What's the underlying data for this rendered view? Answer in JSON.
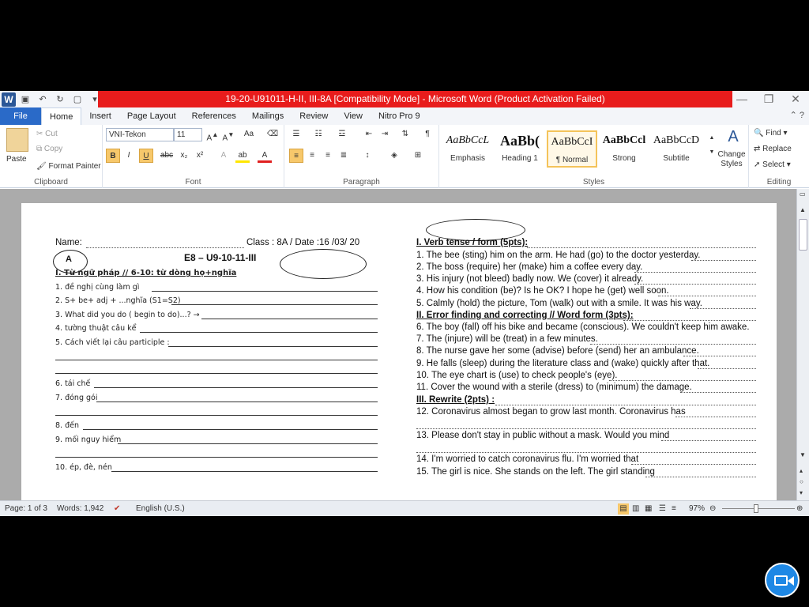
{
  "window": {
    "title": "19-20-U91011-H-II, III-8A [Compatibility Mode] - Microsoft Word (Product Activation Failed)"
  },
  "tabs": [
    "File",
    "Home",
    "Insert",
    "Page Layout",
    "References",
    "Mailings",
    "Review",
    "View",
    "Nitro Pro 9"
  ],
  "ribbon": {
    "clipboard": {
      "paste": "Paste",
      "cut": "Cut",
      "copy": "Copy",
      "format_painter": "Format Painter",
      "label": "Clipboard"
    },
    "font": {
      "name": "VNI-Tekon",
      "size": "11",
      "label": "Font"
    },
    "paragraph": {
      "label": "Paragraph"
    },
    "styles": {
      "label": "Styles",
      "items": [
        {
          "sample": "AaBbCcL",
          "name": "Emphasis"
        },
        {
          "sample": "AaBb(",
          "name": "Heading 1"
        },
        {
          "sample": "AaBbCcI",
          "name": "¶ Normal"
        },
        {
          "sample": "AaBbCcl",
          "name": "Strong"
        },
        {
          "sample": "AaBbCcD",
          "name": "Subtitle"
        }
      ],
      "change_styles": "Change Styles"
    },
    "editing": {
      "find": "Find",
      "replace": "Replace",
      "select": "Select",
      "label": "Editing"
    }
  },
  "doc_left": {
    "name_label": "Name:",
    "class_date": "Class : 8A / Date :16 /03/ 20",
    "oval_a": "A",
    "title": "E8 – U9-10-11-III",
    "section1": "I. Từ ngữ pháp // 6-10: từ dòng họ+nghĩa",
    "items": [
      "1. đề nghị cùng làm gì",
      "2. S+ be+ adj + ...nghĩa (S1=S2)",
      "3. What did you do ( begin to do)...? →",
      "4. tường thuật câu kể",
      "5. Cách viết lại câu participle :",
      "6. tái chế",
      "7. đóng gói",
      "8. đến",
      "9. mối nguy hiểm",
      "10. ép, đè, nén"
    ]
  },
  "doc_right": {
    "section1": "I. Verb tense / form (5pts):",
    "q1": "1. The bee (sting) him on the arm. He had (go) to the doctor yesterday.",
    "q2": "2. The boss (require) her (make) him a coffee every day.",
    "q3": "3. His injury (not bleed) badly now. We (cover) it already.",
    "q4": "4. How his condition (be)? Is he OK? I hope he (get) well soon.",
    "q5": "5. Calmly (hold) the picture, Tom (walk) out with a smile. It was his way.",
    "section2": "II. Error finding and correcting // Word form (3pts):",
    "q6": "6. The boy (fall) off his bike and became (conscious). We couldn't keep him awake.",
    "q7": "7. The (injure) will be (treat) in a few minutes.",
    "q8": "8. The nurse gave her some (advise) before (send) her an ambulance.",
    "q9": "9. He falls (sleep) during the literature class and (wake) quickly after that.",
    "q10": "10. The eye chart is (use) to check people's (eye).",
    "q11": "11. Cover the wound with a sterile (dress) to (minimum) the damage.",
    "section3": "III. Rewrite (2pts) :",
    "q12": "12. Coronavirus almost began to grow last month. Coronavirus has",
    "q13": "13. Please don't stay in public without a mask.  Would you mind",
    "q14": "14. I'm worried to catch coronavirus flu.  I'm worried that",
    "q15": "15. The girl is nice. She stands on the left. The girl standing"
  },
  "status": {
    "page": "Page: 1 of 3",
    "words": "Words: 1,942",
    "language": "English (U.S.)",
    "zoom": "97%"
  }
}
